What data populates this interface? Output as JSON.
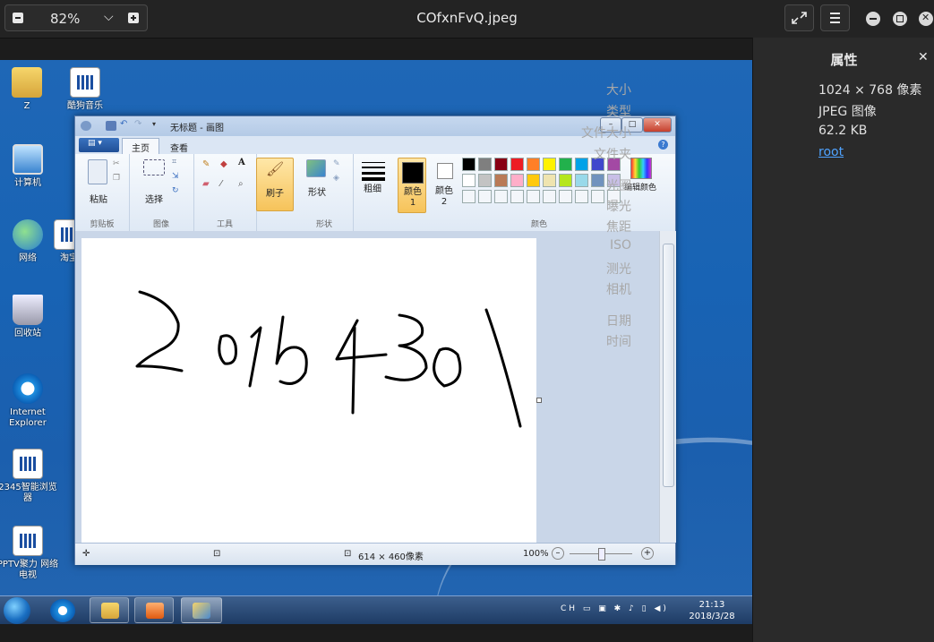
{
  "viewer": {
    "zoom": "82%",
    "filename": "COfxnFvQ.jpeg"
  },
  "desktop": {
    "icons": [
      {
        "label": "Z",
        "type": "folder"
      },
      {
        "label": "酷狗音乐",
        "type": "doc"
      },
      {
        "label": "计算机",
        "type": "pc"
      },
      {
        "label": "网络",
        "type": "globe"
      },
      {
        "label": "淘宝",
        "type": "doc"
      },
      {
        "label": "回收站",
        "type": "bin"
      },
      {
        "label": "Internet Explorer",
        "type": "ie"
      },
      {
        "label": "2345智能浏览器",
        "type": "doc"
      },
      {
        "label": "PPTV聚力 网络电视",
        "type": "doc"
      }
    ]
  },
  "paint": {
    "title": "无标题 - 画图",
    "tabs": [
      "主页",
      "查看"
    ],
    "groups": {
      "clipboard": "剪贴板",
      "image": "图像",
      "tools": "工具",
      "shapes": "形状",
      "colors": "颜色"
    },
    "buttons": {
      "paste": "粘贴",
      "select": "选择",
      "brush": "刷子",
      "shapes": "形状",
      "size": "粗细",
      "color1": "颜色 1",
      "color2": "颜色 2",
      "edit_colors": "编辑颜色"
    },
    "palette": [
      "#000000",
      "#7f7f7f",
      "#880015",
      "#ed1c24",
      "#ff7f27",
      "#fff200",
      "#22b14c",
      "#00a2e8",
      "#3f48cc",
      "#a349a4",
      "#ffffff",
      "#c3c3c3",
      "#b97a57",
      "#ffaec9",
      "#ffc90e",
      "#efe4b0",
      "#b5e61d",
      "#99d9ea",
      "#7092be",
      "#c8bfe7"
    ],
    "handwriting": "2015430",
    "status": {
      "size": "614 × 460像素",
      "zoom": "100%"
    }
  },
  "taskbar": {
    "ime": "CH",
    "time": "21:13",
    "date": "2018/3/28"
  },
  "properties": {
    "title": "属性",
    "rows": [
      {
        "key": "大小",
        "value": "1024 × 768 像素"
      },
      {
        "key": "类型",
        "value": "JPEG 图像"
      },
      {
        "key": "文件大小",
        "value": "62.2 KB"
      },
      {
        "key": "文件夹",
        "value": "root"
      },
      {
        "key": "光圈",
        "value": ""
      },
      {
        "key": "曝光",
        "value": ""
      },
      {
        "key": "焦距",
        "value": ""
      },
      {
        "key": "ISO",
        "value": ""
      },
      {
        "key": "测光",
        "value": ""
      },
      {
        "key": "相机",
        "value": ""
      },
      {
        "key": "日期",
        "value": ""
      },
      {
        "key": "时间",
        "value": ""
      }
    ]
  }
}
